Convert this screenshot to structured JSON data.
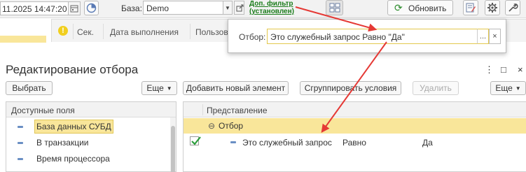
{
  "toolbar": {
    "datetime": "11.2025 14:47:20",
    "base_label": "База:",
    "base_value": "Demo",
    "filter_link_line1": "Доп. фильтр",
    "filter_link_line2": "(установлен)",
    "refresh_label": "Обновить",
    "accent": "#2d8c2d"
  },
  "table": {
    "columns": [
      "Сек.",
      "Дата выполнения",
      "Пользова"
    ]
  },
  "filter_popup": {
    "label": "Отбор:",
    "value": "Это служебный запрос Равно \"Да\"",
    "more_label": "...",
    "clear_label": "×"
  },
  "dialog": {
    "title": "Редактирование отбора",
    "window_controls": [
      "⋮",
      "□",
      "×"
    ],
    "buttons": {
      "select": "Выбрать",
      "more_left": "Еще",
      "add_element": "Добавить новый элемент",
      "group_conditions": "Сгруппировать условия",
      "delete": "Удалить",
      "more_right": "Еще"
    },
    "available_fields": {
      "header": "Доступные поля",
      "items": [
        {
          "label": "База данных СУБД",
          "selected": true
        },
        {
          "label": "В транзакции",
          "selected": false
        },
        {
          "label": "Время процессора",
          "selected": false
        }
      ]
    },
    "filter_tree": {
      "header": "Представление",
      "group_label": "Отбор",
      "group_toggle": "⊖",
      "rows": [
        {
          "checked": true,
          "field": "Это служебный запрос",
          "condition": "Равно",
          "value": "Да"
        }
      ]
    }
  },
  "colors": {
    "selection": "#f9e69a",
    "link": "#1a7c1a",
    "annotation_arrow": "#e53935"
  }
}
